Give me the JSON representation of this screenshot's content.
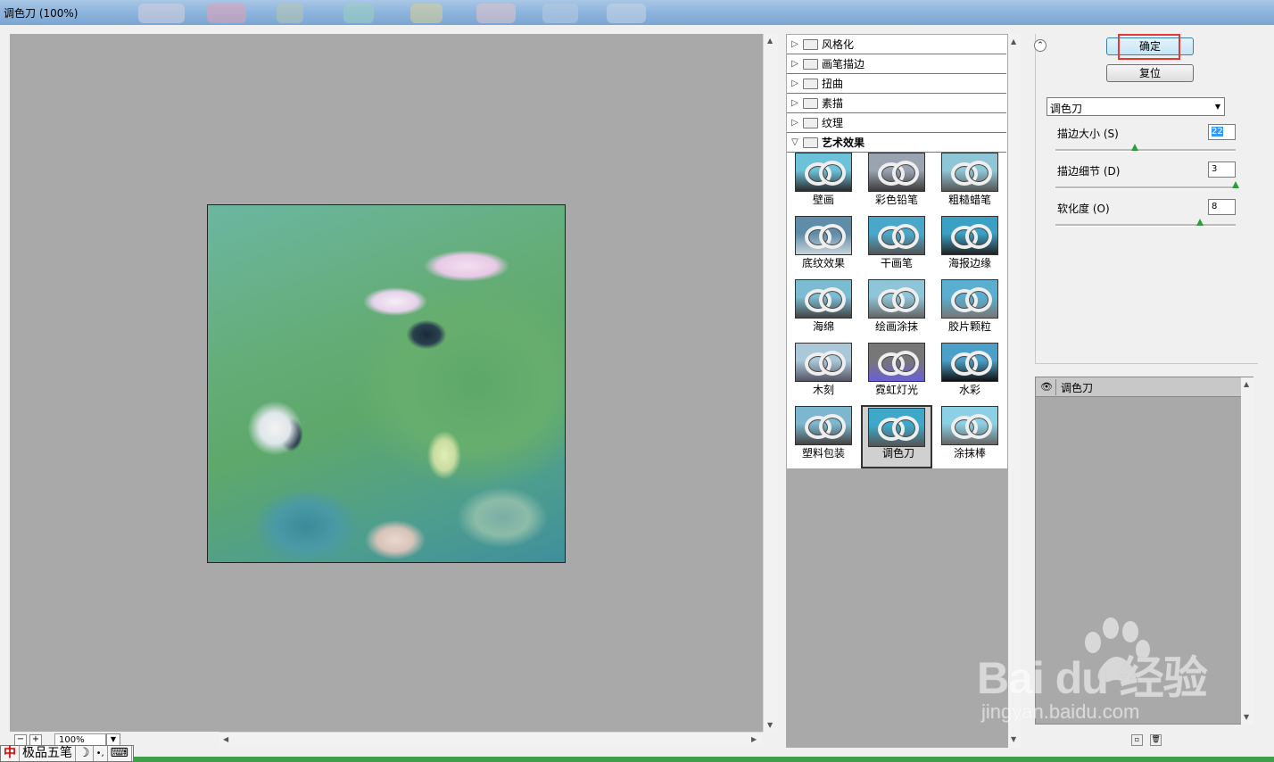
{
  "window": {
    "title": "调色刀 (100%)"
  },
  "categories": [
    {
      "label": "风格化",
      "open": false
    },
    {
      "label": "画笔描边",
      "open": false
    },
    {
      "label": "扭曲",
      "open": false
    },
    {
      "label": "素描",
      "open": false
    },
    {
      "label": "纹理",
      "open": false
    },
    {
      "label": "艺术效果",
      "open": true
    }
  ],
  "filters": [
    "壁画",
    "彩色铅笔",
    "粗糙蜡笔",
    "底纹效果",
    "干画笔",
    "海报边缘",
    "海绵",
    "绘画涂抹",
    "胶片颗粒",
    "木刻",
    "霓虹灯光",
    "水彩",
    "塑料包装",
    "调色刀",
    "涂抹棒"
  ],
  "selected_filter": "调色刀",
  "buttons": {
    "ok": "确定",
    "reset": "复位"
  },
  "filter_select": {
    "value": "调色刀"
  },
  "params": [
    {
      "label": "描边大小 (S)",
      "value": "22",
      "slider": 0.44
    },
    {
      "label": "描边细节 (D)",
      "value": "3",
      "slider": 1.0
    },
    {
      "label": "软化度 (O)",
      "value": "8",
      "slider": 0.8
    }
  ],
  "layers": [
    {
      "name": "调色刀"
    }
  ],
  "zoom": {
    "value": "100%",
    "minus": "−",
    "plus": "+"
  },
  "ime": {
    "name": "极品五笔",
    "logo": "中",
    "moon": "☽",
    "dots": "•,",
    "keyboard": "⌨"
  },
  "watermark": {
    "text": "Bai du 经验",
    "url": "jingyan.baidu.com"
  },
  "colors": {
    "ok_highlight": "#e53935",
    "preview_bg": "#a9a9a9",
    "accent": "#3c7fb1"
  }
}
